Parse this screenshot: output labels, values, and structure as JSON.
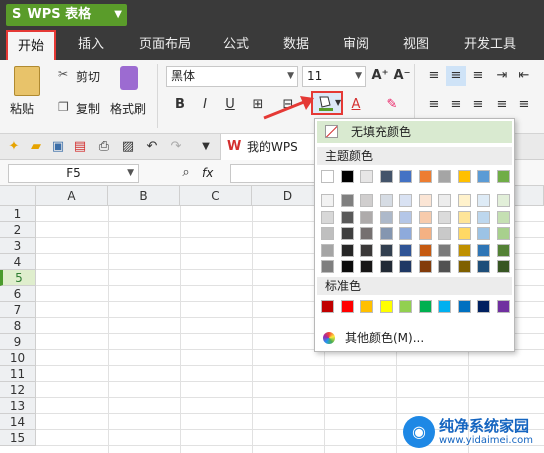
{
  "app": {
    "title": "WPS 表格",
    "logo": "S"
  },
  "tabs": [
    "开始",
    "插入",
    "页面布局",
    "公式",
    "数据",
    "审阅",
    "视图",
    "开发工具"
  ],
  "ribbon": {
    "paste": "粘贴",
    "cut": "剪切",
    "copy": "复制",
    "format_painter": "格式刷",
    "font": "黑体",
    "font_size": "11",
    "bold": "B",
    "italic": "I",
    "underline": "U"
  },
  "doc": {
    "name": "我的WPS"
  },
  "namebox": "F5",
  "fx": "fx",
  "columns": [
    "A",
    "B",
    "C",
    "D"
  ],
  "rows": [
    "1",
    "2",
    "3",
    "4",
    "5",
    "6",
    "7",
    "8",
    "9",
    "10",
    "11",
    "12",
    "13",
    "14",
    "15"
  ],
  "selected_row": "5",
  "popup": {
    "no_fill": "无填充颜色",
    "theme_label": "主题颜色",
    "standard_label": "标准色",
    "more": "其他颜色(M)...",
    "theme_top": [
      "#ffffff",
      "#000000",
      "#e7e6e6",
      "#44546a",
      "#4472c4",
      "#ed7d31",
      "#a5a5a5",
      "#ffc000",
      "#5b9bd5",
      "#70ad47"
    ],
    "theme_shades": [
      [
        "#f2f2f2",
        "#7f7f7f",
        "#d0cece",
        "#d6dce4",
        "#d9e2f3",
        "#fbe5d5",
        "#ededed",
        "#fff2cc",
        "#deebf6",
        "#e2efd9"
      ],
      [
        "#d8d8d8",
        "#595959",
        "#aeabab",
        "#adb9ca",
        "#b4c6e7",
        "#f7cbac",
        "#dbdbdb",
        "#fee599",
        "#bdd7ee",
        "#c5e0b3"
      ],
      [
        "#bfbfbf",
        "#3f3f3f",
        "#757070",
        "#8496b0",
        "#8eaadb",
        "#f4b183",
        "#c9c9c9",
        "#ffd965",
        "#9cc3e5",
        "#a8d08d"
      ],
      [
        "#a5a5a5",
        "#262626",
        "#3a3838",
        "#323f4f",
        "#2f5496",
        "#c55a11",
        "#7b7b7b",
        "#bf9000",
        "#2e75b5",
        "#538135"
      ],
      [
        "#7f7f7f",
        "#0c0c0c",
        "#171616",
        "#222a35",
        "#1f3864",
        "#833c0b",
        "#525252",
        "#7f6000",
        "#1e4e79",
        "#375623"
      ]
    ],
    "standard": [
      "#c00000",
      "#ff0000",
      "#ffc000",
      "#ffff00",
      "#92d050",
      "#00b050",
      "#00b0f0",
      "#0070c0",
      "#002060",
      "#7030a0"
    ]
  },
  "watermark": {
    "title": "纯净系统家园",
    "url": "www.yidaimei.com"
  },
  "colors": {
    "accent": "#5a9c2a",
    "highlight": "#e53935"
  }
}
